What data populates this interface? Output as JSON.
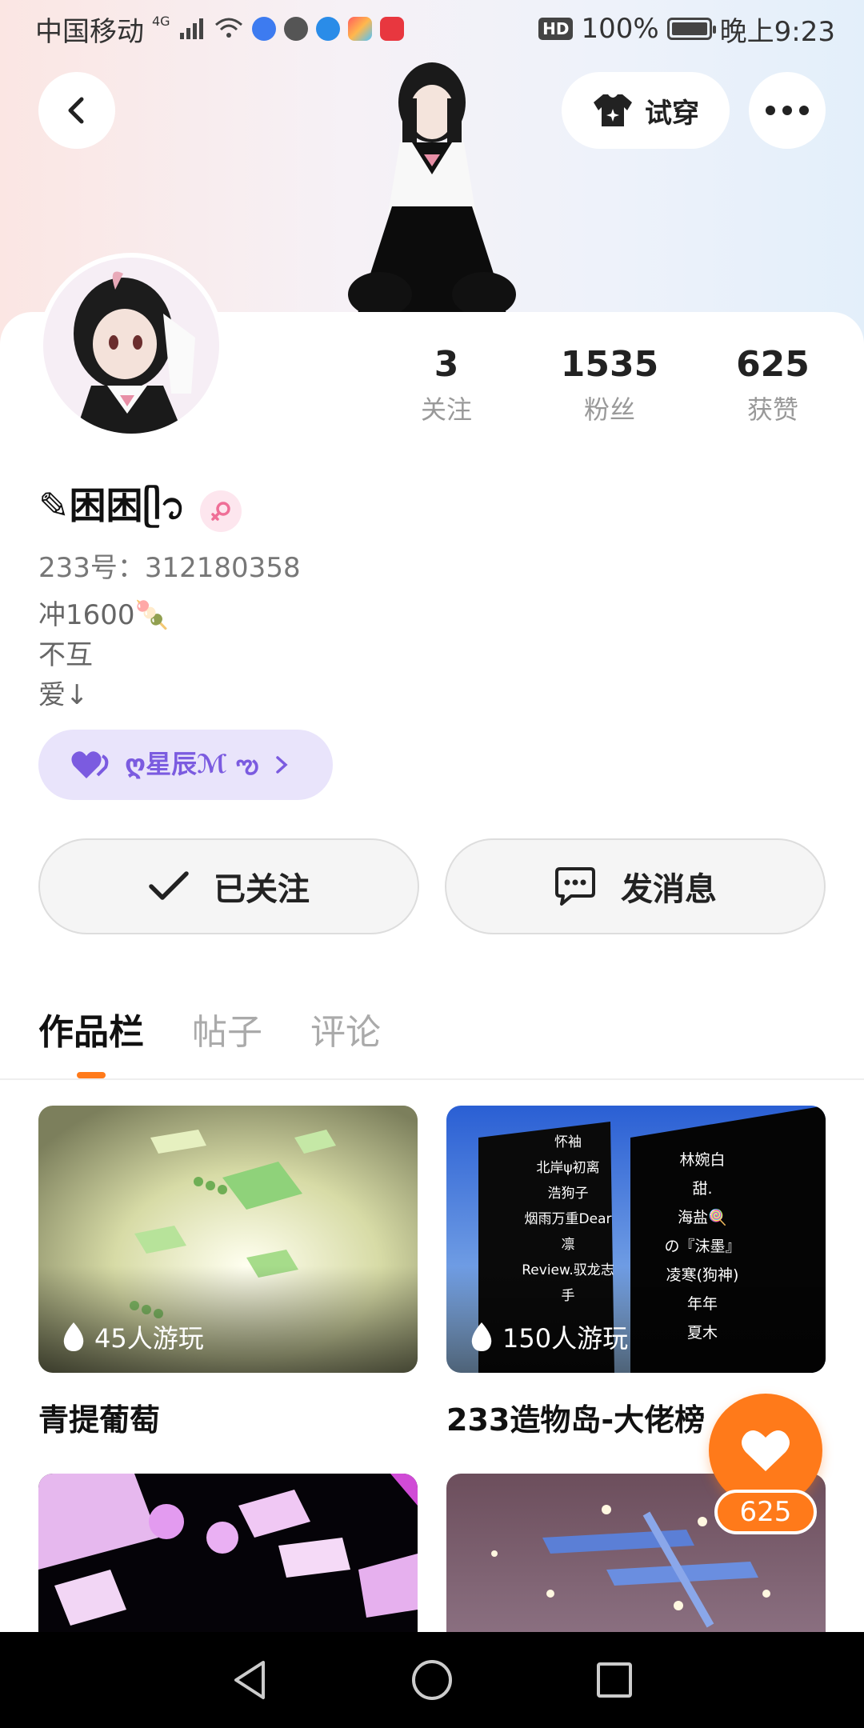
{
  "status_bar": {
    "carrier": "中国移动",
    "network": "4G",
    "hd": "HD",
    "battery": "100%",
    "time": "晚上9:23"
  },
  "header": {
    "try_on_label": "试穿"
  },
  "profile": {
    "stats": [
      {
        "value": "3",
        "label": "关注"
      },
      {
        "value": "1535",
        "label": "粉丝"
      },
      {
        "value": "625",
        "label": "获赞"
      }
    ],
    "username": "✎困困ᥫ᭡",
    "id_line": "233号：312180358",
    "bio_lines": [
      "冲1600🍡",
      "不互",
      "爱↓"
    ],
    "club_name": "ღ星辰ℳ ఌ"
  },
  "actions": {
    "followed_label": "已关注",
    "message_label": "发消息"
  },
  "tabs": [
    "作品栏",
    "帖子",
    "评论"
  ],
  "games": [
    {
      "plays": "45人游玩",
      "title": "青提葡萄"
    },
    {
      "plays": "150人游玩",
      "title": "233造物岛-大佬榜"
    },
    {
      "plays": "",
      "title": ""
    },
    {
      "plays": "",
      "title": ""
    }
  ],
  "board_texts": {
    "left": [
      "怀袖",
      "北岸ψ初离",
      "浩狗子",
      "烟雨万重Dear",
      "凛",
      "Review.驭龙志",
      "手"
    ],
    "right": [
      "林婉白",
      "甜.",
      "海盐🍭",
      "の『沫墨』",
      "凌寒(狗神)",
      "年年",
      "夏木"
    ]
  },
  "fab": {
    "like_count": "625"
  },
  "icons": {
    "back": "back-arrow-icon",
    "shirt": "shirt-icon",
    "more": "more-dots-icon",
    "check": "check-icon",
    "message": "chat-bubble-icon",
    "fire": "fire-icon",
    "heart": "heart-icon",
    "female": "female-icon"
  },
  "colors": {
    "accent": "#ff7a1a",
    "club_bg": "#e9e4fb",
    "club_text": "#7b5be0"
  }
}
